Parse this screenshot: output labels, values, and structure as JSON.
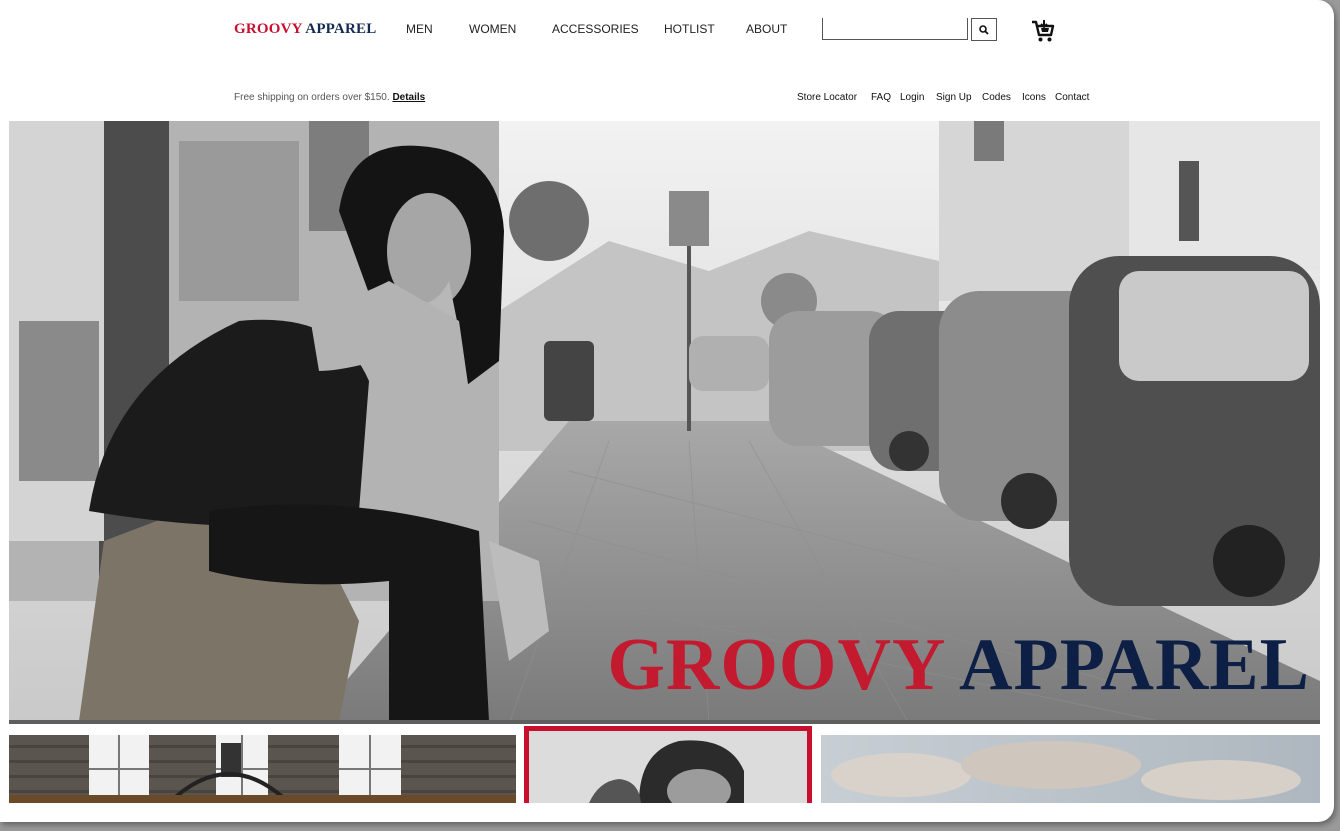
{
  "brand": {
    "word1": "GROOVY",
    "word2": "APPAREL",
    "red": "#c8102e",
    "navy": "#152a52"
  },
  "nav": [
    "MEN",
    "WOMEN",
    "ACCESSORIES",
    "HOTLIST",
    "ABOUT"
  ],
  "search": {
    "placeholder": "",
    "button_icon": "search-icon"
  },
  "cart": {
    "icon": "cart-icon"
  },
  "shipping": {
    "text": "Free shipping on orders over $150.",
    "link": "Details"
  },
  "utility_links": [
    "Store Locator",
    "FAQ",
    "Login",
    "Sign Up",
    "Codes",
    "Icons",
    "Contact"
  ],
  "hero": {
    "word1": "GROOVY",
    "word2": "APPAREL",
    "image": "black-and-white street photo of a woman sitting on a ledge beside parked cars"
  },
  "tiles": [
    {
      "image": "brick building facade with white windows"
    },
    {
      "image": "portrait of a man with dark hair"
    },
    {
      "image": "cloudy sky landscape"
    }
  ]
}
